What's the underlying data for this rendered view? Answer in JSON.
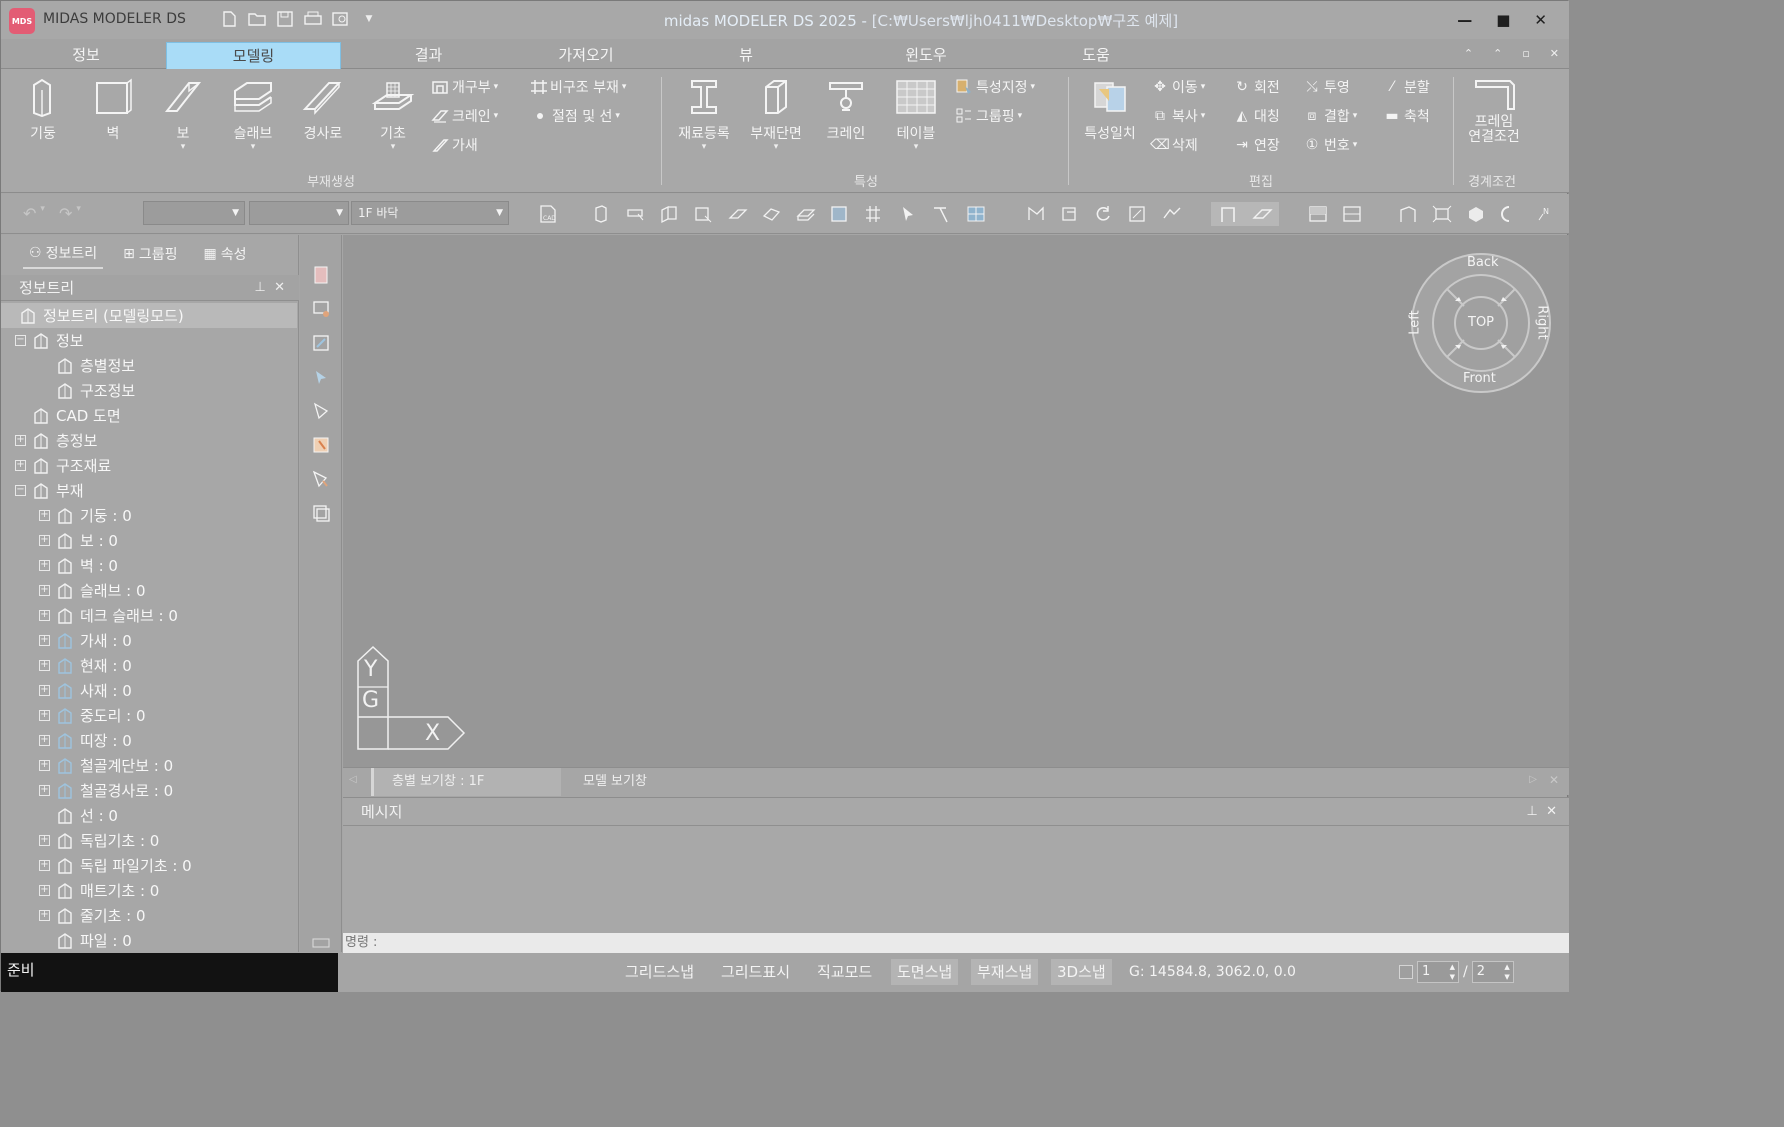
{
  "app": {
    "logo": "MDS",
    "name": "MIDAS MODELER DS",
    "title_app": "midas MODELER DS 2025 - ",
    "title_path": "[C:₩Users₩ljh0411₩Desktop₩구조 예제]"
  },
  "menu_tabs": [
    "정보",
    "모델링",
    "결과",
    "가져오기",
    "뷰",
    "윈도우",
    "도움"
  ],
  "active_tab": "모델링",
  "ribbon": {
    "member_create": {
      "buttons": [
        "기둥",
        "벽",
        "보",
        "슬래브",
        "경사로",
        "기초"
      ],
      "small": [
        "개구부",
        "크레인",
        "가새",
        "비구조 부재",
        "절점 및 선"
      ],
      "group_label": "부재생성"
    },
    "property": {
      "buttons": [
        "재료등록",
        "부재단면",
        "크레인",
        "테이블"
      ],
      "small": [
        "특성지정",
        "그룹핑"
      ],
      "group_label": "특성"
    },
    "edit": {
      "button": "특성일치",
      "small": [
        "이동",
        "회전",
        "투영",
        "분할",
        "복사",
        "대칭",
        "결합",
        "축척",
        "삭제",
        "연장",
        "번호"
      ],
      "group_label": "편집"
    },
    "boundary": {
      "button_line1": "프레임",
      "button_line2": "연결조건",
      "group_label": "경계조건"
    }
  },
  "toolbar": {
    "combo1": "",
    "combo2": "",
    "combo3": "1F 바닥"
  },
  "left_panel": {
    "tabs": [
      "정보트리",
      "그룹핑",
      "속성"
    ],
    "header": "정보트리",
    "tree": [
      {
        "label": "정보트리 (모델링모드)",
        "level": 0,
        "exp": "",
        "icon": "tree-root"
      },
      {
        "label": "정보",
        "level": 0,
        "exp": "-",
        "icon": "building"
      },
      {
        "label": "층별정보",
        "level": 1,
        "exp": "",
        "icon": "floor"
      },
      {
        "label": "구조정보",
        "level": 1,
        "exp": "",
        "icon": "structure"
      },
      {
        "label": "CAD 도면",
        "level": 0,
        "exp": "",
        "icon": "cad"
      },
      {
        "label": "층정보",
        "level": 0,
        "exp": "+",
        "icon": "floor"
      },
      {
        "label": "구조재료",
        "level": 0,
        "exp": "+",
        "icon": "material"
      },
      {
        "label": "부재",
        "level": 0,
        "exp": "-",
        "icon": "member"
      },
      {
        "label": "기둥 : 0",
        "level": 1,
        "exp": "+",
        "icon": "column"
      },
      {
        "label": "보 : 0",
        "level": 1,
        "exp": "+",
        "icon": "beam"
      },
      {
        "label": "벽 : 0",
        "level": 1,
        "exp": "+",
        "icon": "wall"
      },
      {
        "label": "슬래브 : 0",
        "level": 1,
        "exp": "+",
        "icon": "slab"
      },
      {
        "label": "데크 슬래브 : 0",
        "level": 1,
        "exp": "+",
        "icon": "deck"
      },
      {
        "label": "가새 : 0",
        "level": 1,
        "exp": "+",
        "icon": "brace"
      },
      {
        "label": "현재 : 0",
        "level": 1,
        "exp": "+",
        "icon": "truss"
      },
      {
        "label": "사재 : 0",
        "level": 1,
        "exp": "+",
        "icon": "diagonal"
      },
      {
        "label": "중도리 : 0",
        "level": 1,
        "exp": "+",
        "icon": "purlin"
      },
      {
        "label": "띠장 : 0",
        "level": 1,
        "exp": "+",
        "icon": "girt"
      },
      {
        "label": "철골계단보 : 0",
        "level": 1,
        "exp": "+",
        "icon": "stair"
      },
      {
        "label": "철골경사로 : 0",
        "level": 1,
        "exp": "+",
        "icon": "ramp"
      },
      {
        "label": "선 : 0",
        "level": 1,
        "exp": "",
        "icon": "line"
      },
      {
        "label": "독립기초 : 0",
        "level": 1,
        "exp": "+",
        "icon": "footing"
      },
      {
        "label": "독립 파일기초 : 0",
        "level": 1,
        "exp": "+",
        "icon": "pile-footing"
      },
      {
        "label": "매트기초 : 0",
        "level": 1,
        "exp": "+",
        "icon": "mat"
      },
      {
        "label": "줄기초 : 0",
        "level": 1,
        "exp": "+",
        "icon": "strip-footing"
      },
      {
        "label": "파일 : 0",
        "level": 1,
        "exp": "",
        "icon": "pile"
      }
    ]
  },
  "viewcube": {
    "top": "TOP",
    "back": "Back",
    "front": "Front",
    "left": "Left",
    "right": "Right"
  },
  "axes": {
    "y": "Y",
    "g": "G",
    "x": "X"
  },
  "doc_tabs": [
    "층별 보기창 : 1F",
    "모델 보기창"
  ],
  "message": {
    "header": "메시지",
    "command_prompt": "명령 :"
  },
  "status": {
    "ready": "준비",
    "snaps": [
      "그리드스냅",
      "그리드표시",
      "직교모드",
      "도면스냅",
      "부재스냅",
      "3D스냅"
    ],
    "snaps_on": [
      "도면스냅",
      "부재스냅",
      "3D스냅"
    ],
    "coord": "G: 14584.8, 3062.0, 0.0",
    "page_current": "1",
    "page_total": "2",
    "page_sep": "/"
  },
  "colors": {
    "accent_tab": "#a9dcf7",
    "logo": "#e35c74",
    "ready_bar": "#121212"
  }
}
